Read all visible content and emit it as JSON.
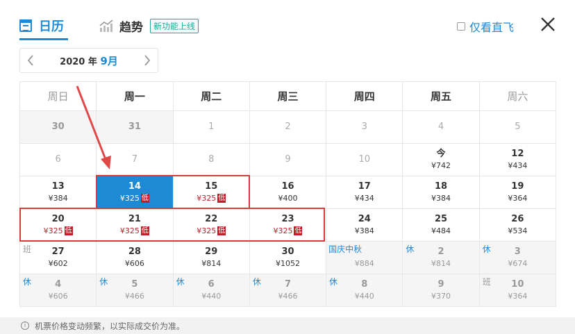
{
  "tabs": {
    "calendar_label": "日历",
    "trend_label": "趋势",
    "new_badge": "新功能上线"
  },
  "direct_only_label": "仅看直飞",
  "month_nav": {
    "year_text": "2020 年",
    "month_text": "9月"
  },
  "weekdays": [
    "周日",
    "周一",
    "周二",
    "周三",
    "周四",
    "周五",
    "周六"
  ],
  "weeks": [
    [
      {
        "day": "30",
        "price": "",
        "past": true,
        "grey": true
      },
      {
        "day": "31",
        "price": "",
        "past": true,
        "grey": true
      },
      {
        "day": "1",
        "price": "",
        "past": true
      },
      {
        "day": "2",
        "price": "",
        "past": true
      },
      {
        "day": "3",
        "price": "",
        "past": true
      },
      {
        "day": "4",
        "price": "",
        "past": true
      },
      {
        "day": "5",
        "price": "",
        "past": true
      }
    ],
    [
      {
        "day": "6",
        "price": "",
        "past": true
      },
      {
        "day": "7",
        "price": "",
        "past": true
      },
      {
        "day": "8",
        "price": "",
        "past": true
      },
      {
        "day": "9",
        "price": "",
        "past": true
      },
      {
        "day": "10",
        "price": "",
        "past": true
      },
      {
        "day": "今",
        "price": "¥742"
      },
      {
        "day": "12",
        "price": "¥434"
      }
    ],
    [
      {
        "day": "13",
        "price": "¥384"
      },
      {
        "day": "14",
        "price": "¥325",
        "low": "低",
        "selected": true
      },
      {
        "day": "15",
        "price": "¥325",
        "low": "低"
      },
      {
        "day": "16",
        "price": "¥400"
      },
      {
        "day": "17",
        "price": "¥434"
      },
      {
        "day": "18",
        "price": "¥384"
      },
      {
        "day": "19",
        "price": "¥364"
      }
    ],
    [
      {
        "day": "20",
        "price": "¥325",
        "low": "低"
      },
      {
        "day": "21",
        "price": "¥325",
        "low": "低"
      },
      {
        "day": "22",
        "price": "¥325",
        "low": "低"
      },
      {
        "day": "23",
        "price": "¥325",
        "low": "低"
      },
      {
        "day": "24",
        "price": "¥384"
      },
      {
        "day": "25",
        "price": "¥484"
      },
      {
        "day": "26",
        "price": "¥534"
      }
    ],
    [
      {
        "day": "27",
        "price": "¥602",
        "corner": "班",
        "ban": true
      },
      {
        "day": "28",
        "price": "¥606"
      },
      {
        "day": "29",
        "price": "¥814"
      },
      {
        "day": "30",
        "price": "¥1052"
      },
      {
        "day": "",
        "price": "¥884",
        "holiday": "国庆中秋",
        "grey": true
      },
      {
        "day": "2",
        "price": "¥814",
        "corner": "休",
        "grey": true
      },
      {
        "day": "3",
        "price": "¥674",
        "corner": "休",
        "grey": true
      }
    ],
    [
      {
        "day": "4",
        "price": "¥606",
        "corner": "休",
        "grey": true
      },
      {
        "day": "5",
        "price": "¥466",
        "corner": "休",
        "grey": true
      },
      {
        "day": "6",
        "price": "¥440",
        "corner": "休",
        "grey": true
      },
      {
        "day": "7",
        "price": "¥466",
        "corner": "休",
        "grey": true
      },
      {
        "day": "8",
        "price": "¥440",
        "corner": "休",
        "grey": true
      },
      {
        "day": "9",
        "price": "¥370",
        "grey": true
      },
      {
        "day": "10",
        "price": "¥364",
        "corner": "班",
        "ban": true,
        "grey": true
      }
    ]
  ],
  "footer_note": "机票价格变动频繁，以实际成交价为准。",
  "colors": {
    "accent": "#1e8ad6",
    "low_price": "#c0202a",
    "highlight_box": "#d63b3b"
  }
}
